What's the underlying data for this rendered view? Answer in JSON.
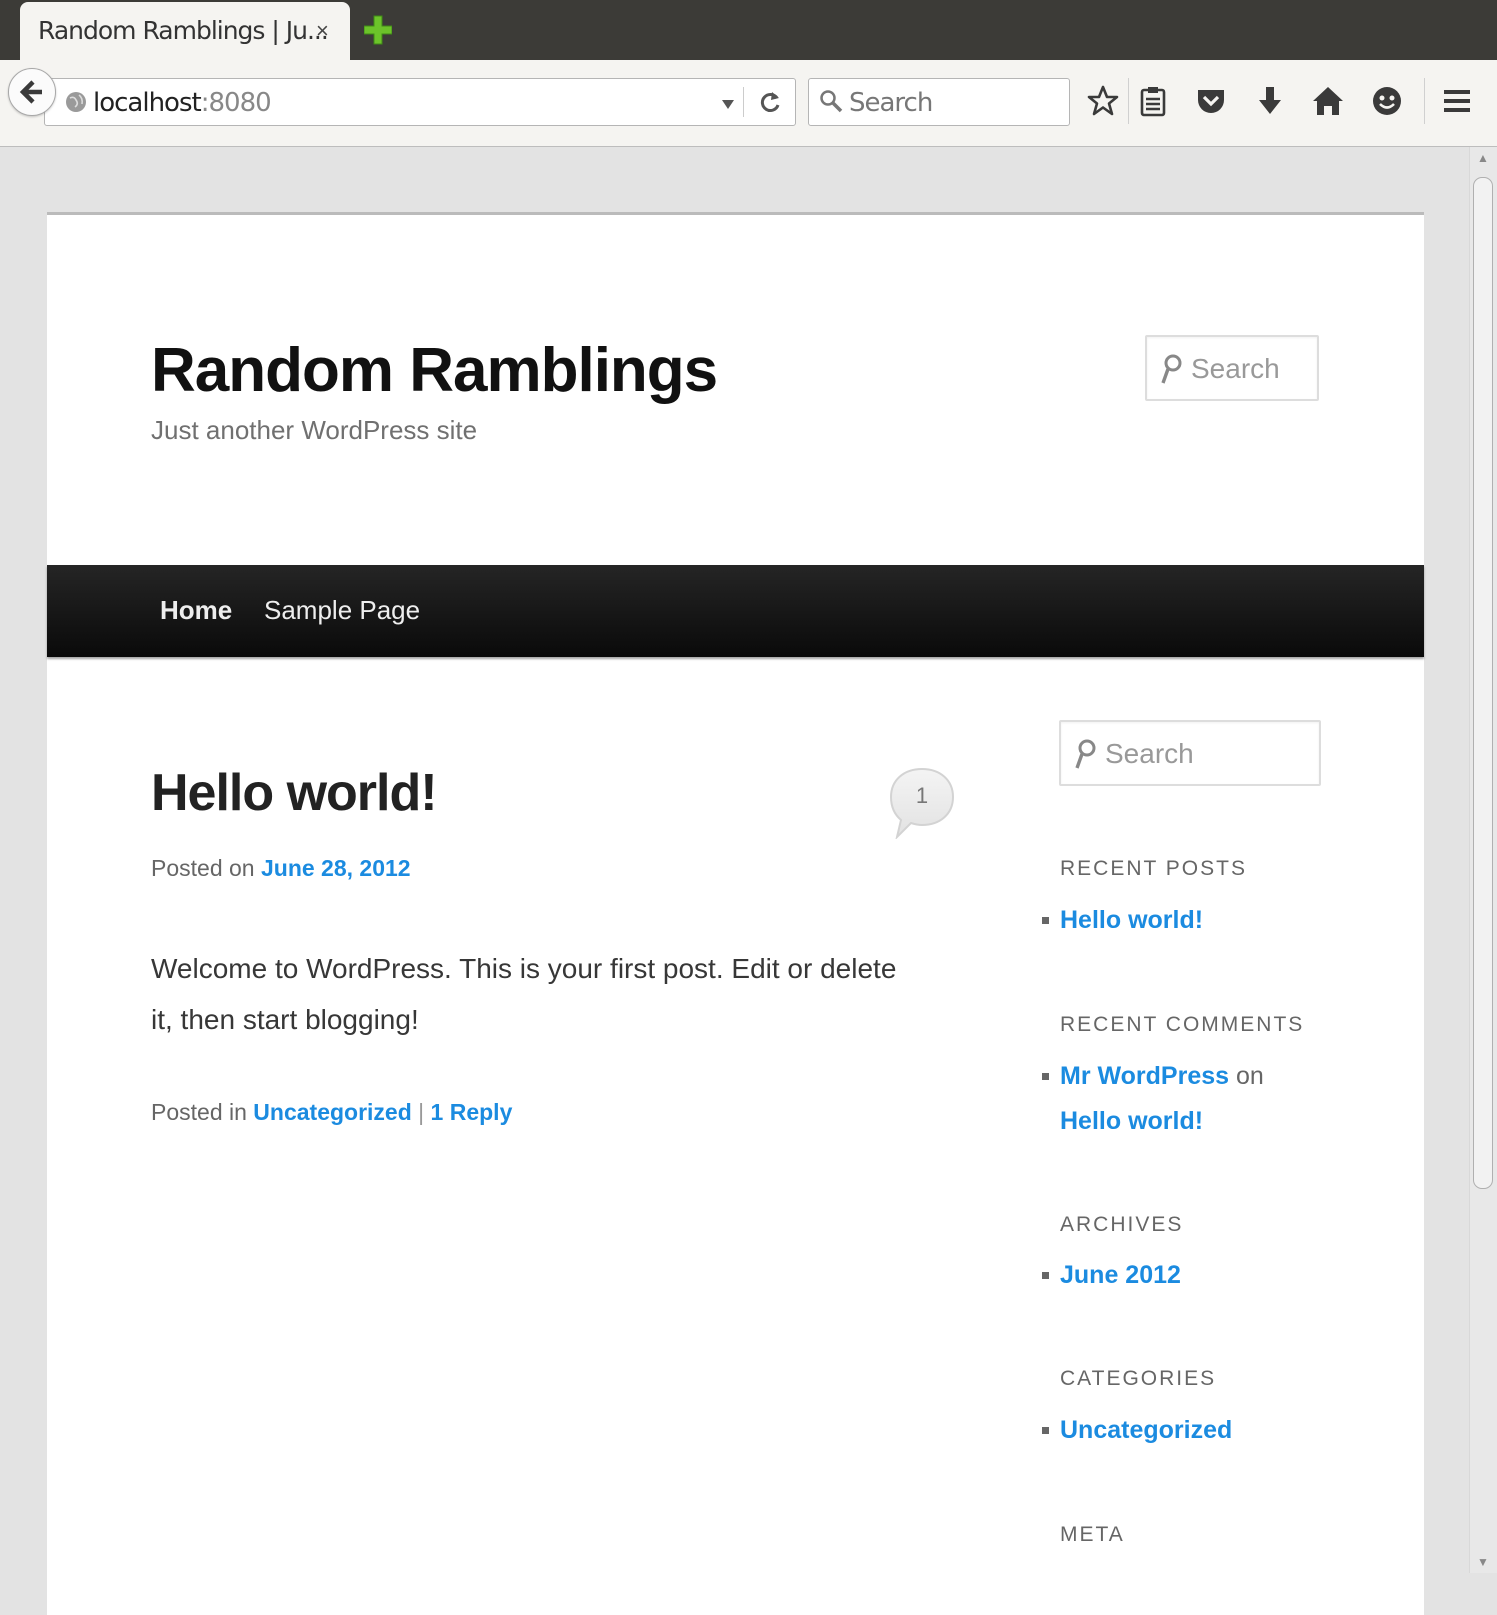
{
  "browser": {
    "tab_title": "Random Ramblings | Ju...",
    "tab_close": "×",
    "url_host": "localhost",
    "url_port": ":8080",
    "search_placeholder": "Search",
    "icons": [
      "back-arrow-icon",
      "globe-icon",
      "dropdown-icon",
      "reload-icon",
      "search-icon",
      "bookmark-star-icon",
      "reading-list-icon",
      "pocket-icon",
      "download-icon",
      "home-icon",
      "smiley-icon",
      "hamburger-menu-icon",
      "new-tab-icon"
    ]
  },
  "site": {
    "title": "Random Ramblings",
    "description": "Just another WordPress site",
    "search_placeholder": "Search"
  },
  "nav": {
    "items": [
      {
        "label": "Home"
      },
      {
        "label": "Sample Page"
      }
    ]
  },
  "post": {
    "title": "Hello world!",
    "comment_count": "1",
    "posted_on_prefix": "Posted on",
    "date": "June 28, 2012",
    "body": "Welcome to WordPress. This is your first post. Edit or delete it, then start blogging!",
    "posted_in_prefix": "Posted in",
    "category": "Uncategorized",
    "separator": "|",
    "reply_link": "1 Reply"
  },
  "sidebar": {
    "search_placeholder": "Search",
    "recent_posts_title": "RECENT POSTS",
    "recent_posts": [
      "Hello world!"
    ],
    "recent_comments_title": "RECENT COMMENTS",
    "recent_comment": {
      "author": "Mr WordPress",
      "on": "on",
      "post": "Hello world!"
    },
    "archives_title": "ARCHIVES",
    "archives": [
      "June 2012"
    ],
    "categories_title": "CATEGORIES",
    "categories": [
      "Uncategorized"
    ],
    "meta_title": "META"
  },
  "colors": {
    "link": "#1b8be0",
    "nav_bg": "#0a0a0a",
    "chrome_dark": "#3c3b37",
    "new_tab_green": "#6cc32a"
  }
}
